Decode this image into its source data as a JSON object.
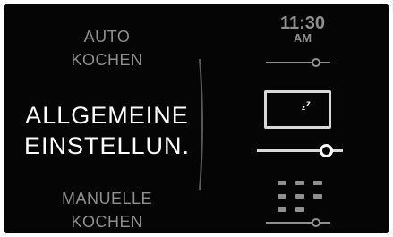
{
  "menu": {
    "auto": {
      "line1": "AUTO",
      "line2": "KOCHEN"
    },
    "general": {
      "line1": "ALLGEMEINE",
      "line2": "EINSTELLUN."
    },
    "manual": {
      "line1": "MANUELLE",
      "line2": "KOCHEN"
    }
  },
  "clock": {
    "time": "11:30",
    "ampm": "AM"
  },
  "icons": {
    "clock_slider": "slider-icon",
    "sleep": "moon-sleep-icon",
    "main_slider": "slider-icon",
    "keypad": "keypad-grid-icon",
    "bottom_slider": "slider-icon"
  },
  "colors": {
    "background": "#050505",
    "active_text": "#ffffff",
    "inactive_text": "#8f8f8f",
    "highlight_border": "#d9d9d9"
  }
}
